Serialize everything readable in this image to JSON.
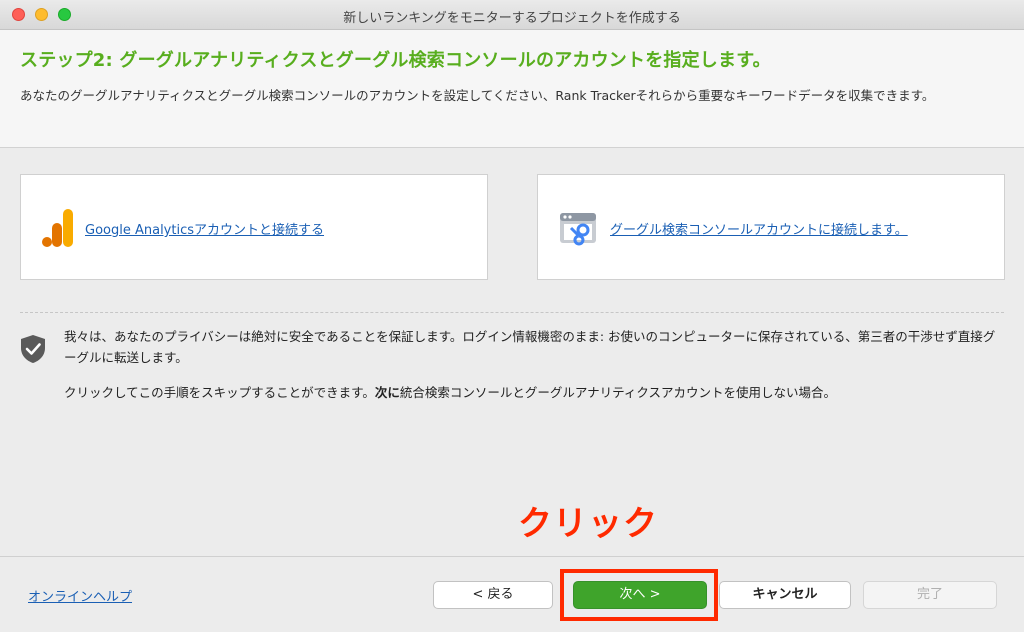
{
  "window": {
    "title": "新しいランキングをモニターするプロジェクトを作成する"
  },
  "header": {
    "step_title": "ステップ2: グーグルアナリティクスとグーグル検索コンソールのアカウントを指定します。",
    "description": "あなたのグーグルアナリティクスとグーグル検索コンソールのアカウントを設定してください、Rank Trackerそれらから重要なキーワードデータを収集できます。"
  },
  "cards": {
    "ga_link": "Google Analyticsアカウントと接続する",
    "gsc_link": "グーグル検索コンソールアカウントに接続します。"
  },
  "privacy": {
    "text": "我々は、あなたのプライバシーは絶対に安全であることを保証します。ログイン情報機密のまま: お使いのコンピューターに保存されている、第三者の干渉せず直接グーグルに転送します。",
    "skip_prefix": "クリックしてこの手順をスキップすることができます。",
    "skip_bold": "次に",
    "skip_suffix": "統合検索コンソールとグーグルアナリティクスアカウントを使用しない場合。"
  },
  "annotation": {
    "text": "クリック",
    "color": "#ff2a00"
  },
  "footer": {
    "help_link": "オンラインヘルプ",
    "back": "< 戻る",
    "next": "次へ >",
    "cancel": "キャンセル",
    "finish": "完了"
  },
  "colors": {
    "accent_green": "#58ae1e",
    "link_blue": "#1a5fb4",
    "next_button": "#3fa42b"
  }
}
